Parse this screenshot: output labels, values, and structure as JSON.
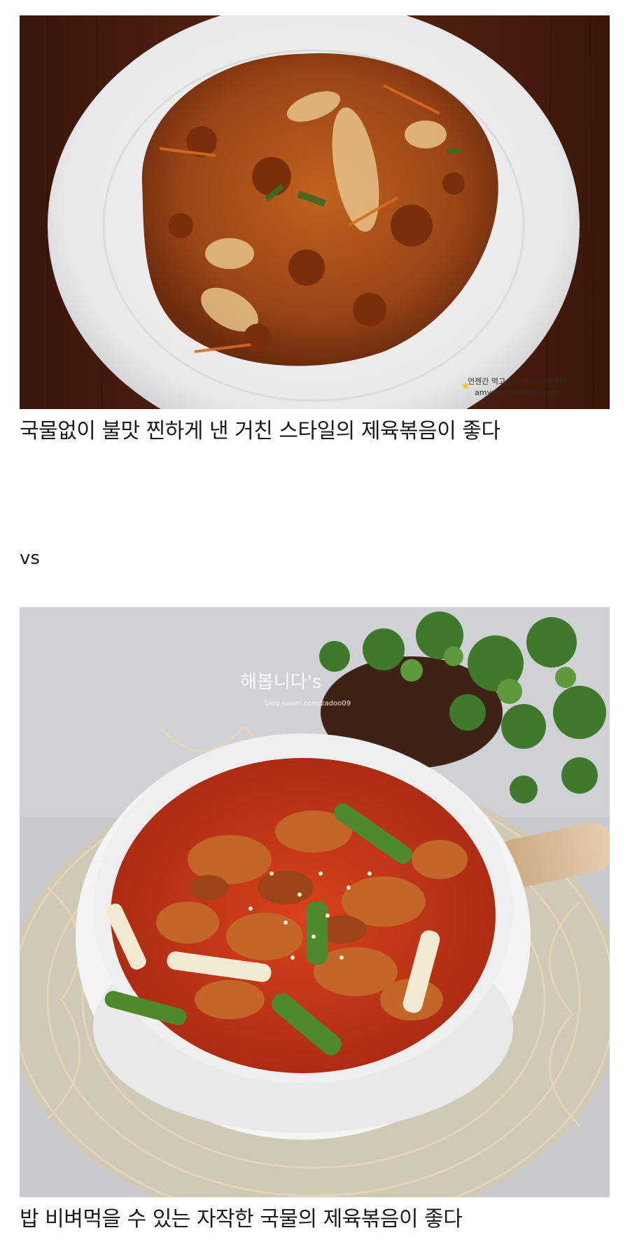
{
  "post": {
    "caption_1": "국물없이 불맛 찐하게 낸 거친 스타일의 제육볶음이 좋다",
    "vs_text": "vs",
    "caption_2": "밥 비벼먹을 수 있는 자작한 국물의 제육볶음이 좋다"
  },
  "photos": {
    "photo_1_watermark_line1": "언젠간 먹고 말거야~ 나의 TM",
    "photo_1_watermark_line2": "amyzzung.tistory.com",
    "photo_2_watermark_title": "해봅니다's",
    "photo_2_watermark_url": "blog.naver.com/zadoo09"
  },
  "colors": {
    "text": "#1b1b1b",
    "background": "#ffffff",
    "wood_table": "#4a1e10",
    "dry_stirfry": "#a8501c",
    "stew_broth": "#c83a1a",
    "counter_grey": "#c9cbce"
  }
}
